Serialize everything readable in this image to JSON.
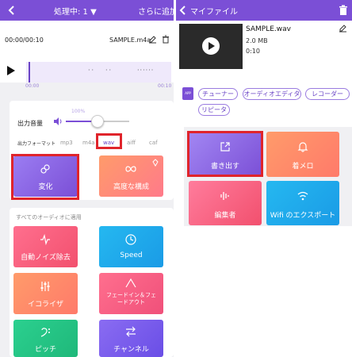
{
  "left": {
    "topbar": {
      "processing_label": "処理中: 1 ▼",
      "add_more_label": "さらに追加"
    },
    "file": {
      "time": "00:00/00:10",
      "name": "SAMPLE.m4a"
    },
    "wave": {
      "start_label": "00:00",
      "end_label": "00:10"
    },
    "volume": {
      "label": "出力音量",
      "percent_label": "100%",
      "level": 0.5
    },
    "format": {
      "label": "出力フォーマット",
      "options": [
        "mp3",
        "m4a",
        "wav",
        "aiff",
        "caf"
      ],
      "selected": "wav"
    },
    "main_tiles": {
      "convert": "変化",
      "advanced": "高度な構成"
    },
    "section_label": "すべてのオーディオに適用",
    "tiles": {
      "noise": "自動ノイズ除去",
      "speed": "Speed",
      "equalizer": "イコライザ",
      "fade": "フェードイン＆フェードアウト",
      "pitch": "ピッチ",
      "channel": "チャンネル"
    }
  },
  "right": {
    "topbar": {
      "title": "マイファイル"
    },
    "file": {
      "name": "SAMPLE.wav",
      "size": "2.0 MB",
      "duration": "0:10"
    },
    "app_badge": "APP",
    "chips": [
      "チューナー",
      "オーディオエディタ",
      "レコーダー",
      "リピータ"
    ],
    "tiles": {
      "export": "書き出す",
      "ringtone": "着メロ",
      "editor": "編集者",
      "wifi": "Wifi のエクスポート"
    }
  },
  "colors": {
    "accent": "#7b4fd6",
    "highlight_red": "#e0242b"
  }
}
